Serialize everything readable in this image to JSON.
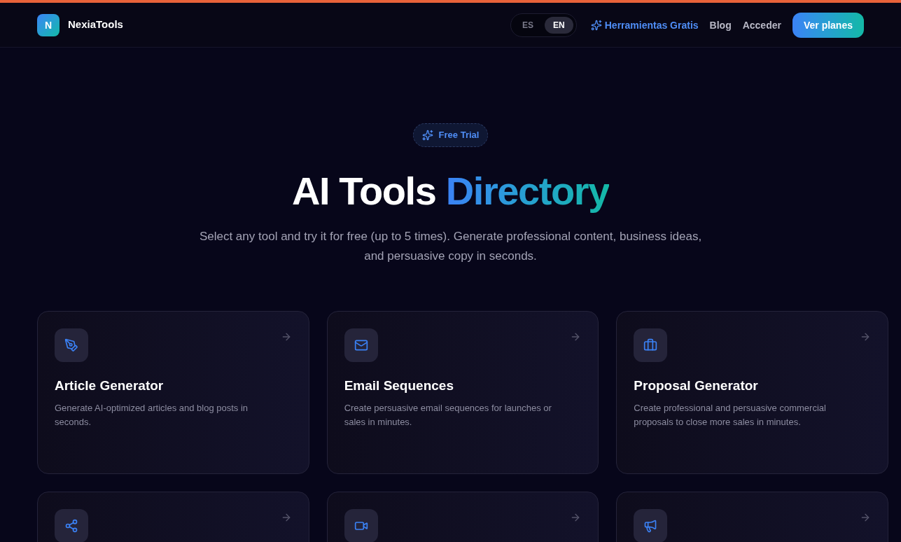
{
  "brand": {
    "logo_letter": "N",
    "name": "NexiaTools"
  },
  "languages": [
    {
      "label": "ES",
      "selected": false
    },
    {
      "label": "EN",
      "selected": true
    }
  ],
  "nav": {
    "free_tools": "Herramientas Gratis",
    "links": [
      "Blog",
      "Acceder"
    ],
    "cta": "Ver planes"
  },
  "hero": {
    "badge": "Free Trial",
    "title": "AI Tools",
    "title_highlight": "Directory",
    "subtitle_lines": [
      "Select any tool and try it for free (up to 5 times). Generate professional content, business ideas,",
      "and persuasive copy in seconds."
    ]
  },
  "tools": [
    {
      "kind": "tool",
      "title": "Article Generator",
      "description": "Generate AI-optimized articles and blog posts in seconds."
    },
    {
      "kind": "tool",
      "title": "Email Sequences",
      "description": "Create persuasive email sequences for launches or sales in minutes."
    },
    {
      "kind": "tool",
      "title": "Proposal Generator",
      "description": "Create professional and persuasive commercial proposals to close more sales in minutes."
    },
    {
      "kind": "tool"
    },
    {
      "kind": "tool"
    },
    {
      "kind": "tool"
    }
  ]
}
